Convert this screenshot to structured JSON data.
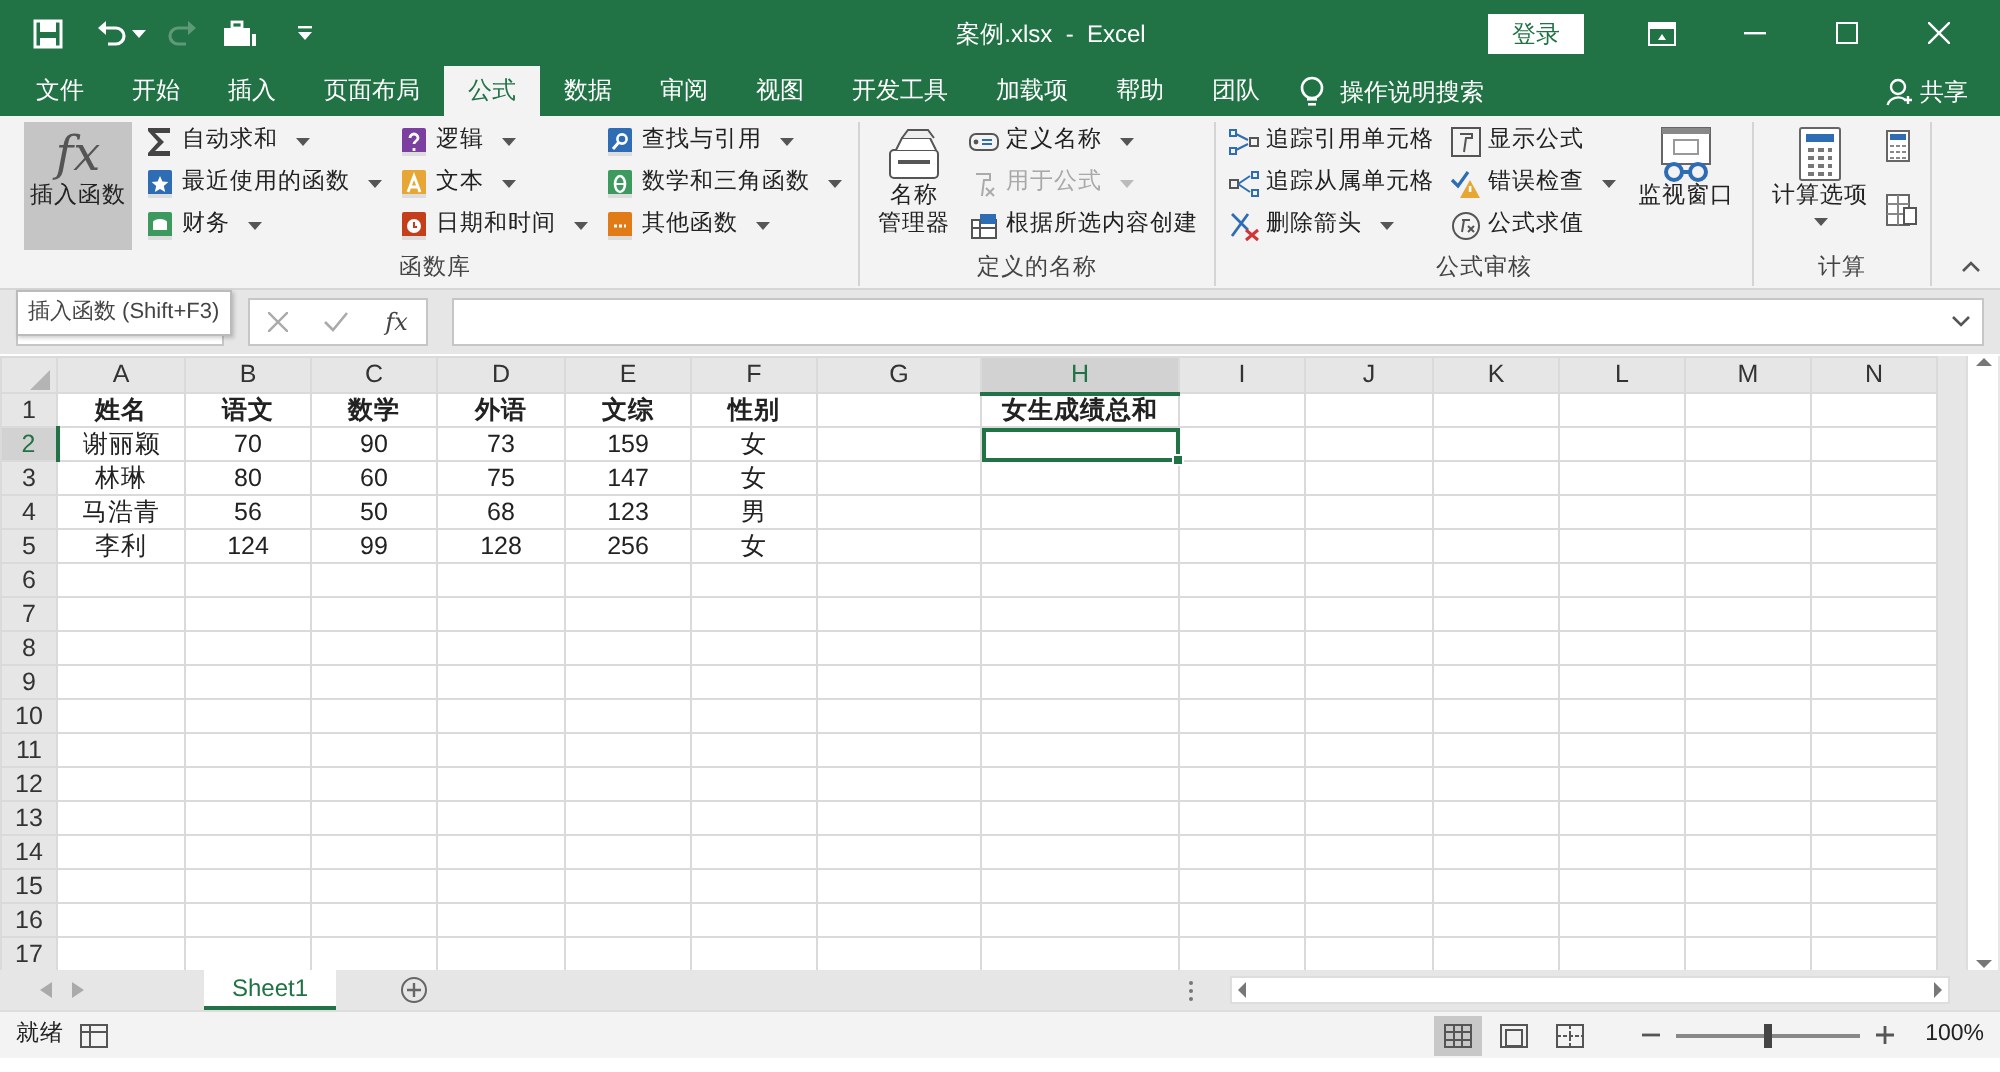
{
  "window": {
    "title": "案例.xlsx  -  Excel",
    "login": "登录"
  },
  "tabs": [
    {
      "label": "文件",
      "selected": false
    },
    {
      "label": "开始",
      "selected": false
    },
    {
      "label": "插入",
      "selected": false
    },
    {
      "label": "页面布局",
      "selected": false
    },
    {
      "label": "公式",
      "selected": true
    },
    {
      "label": "数据",
      "selected": false
    },
    {
      "label": "审阅",
      "selected": false
    },
    {
      "label": "视图",
      "selected": false
    },
    {
      "label": "开发工具",
      "selected": false
    },
    {
      "label": "加载项",
      "selected": false
    },
    {
      "label": "帮助",
      "selected": false
    },
    {
      "label": "团队",
      "selected": false
    }
  ],
  "tell_me": "操作说明搜索",
  "share": "共享",
  "ribbon": [
    {
      "label": "函数库",
      "large": [
        {
          "label": "插入函数",
          "glyph": "fx",
          "pressed": true
        }
      ],
      "columns": [
        [
          {
            "label": "自动求和",
            "dropdown": true
          },
          {
            "label": "最近使用的函数",
            "dropdown": true
          },
          {
            "label": "财务",
            "dropdown": true
          }
        ],
        [
          {
            "label": "逻辑",
            "dropdown": true
          },
          {
            "label": "文本",
            "dropdown": true
          },
          {
            "label": "日期和时间",
            "dropdown": true
          }
        ],
        [
          {
            "label": "查找与引用",
            "dropdown": true
          },
          {
            "label": "数学和三角函数",
            "dropdown": true
          },
          {
            "label": "其他函数",
            "dropdown": true
          }
        ]
      ]
    },
    {
      "label": "定义的名称",
      "large": [
        {
          "label": [
            "名称",
            "管理器"
          ],
          "pressed": false
        }
      ],
      "columns": [
        [
          {
            "label": "定义名称",
            "dropdown": true,
            "disabled": false
          },
          {
            "label": "用于公式",
            "dropdown": true,
            "disabled": true
          },
          {
            "label": "根据所选内容创建",
            "dropdown": false,
            "disabled": false
          }
        ]
      ]
    },
    {
      "label": "公式审核",
      "columns": [
        [
          {
            "label": "追踪引用单元格",
            "dropdown": false
          },
          {
            "label": "追踪从属单元格",
            "dropdown": false
          },
          {
            "label": "删除箭头",
            "dropdown": true
          }
        ],
        [
          {
            "label": "显示公式",
            "dropdown": false
          },
          {
            "label": "错误检查",
            "dropdown": true
          },
          {
            "label": "公式求值",
            "dropdown": false
          }
        ]
      ],
      "large_after": [
        {
          "label": "监视窗口",
          "pressed": false
        }
      ]
    },
    {
      "label": "计算",
      "large": [
        {
          "label": "计算选项",
          "dropdown": true,
          "pressed": false
        }
      ]
    }
  ],
  "tooltip": "插入函数 (Shift+F3)",
  "formula_bar": {
    "fx": "fx"
  },
  "columns": [
    {
      "letter": "A",
      "selected": false
    },
    {
      "letter": "B",
      "selected": false
    },
    {
      "letter": "C",
      "selected": false
    },
    {
      "letter": "D",
      "selected": false
    },
    {
      "letter": "E",
      "selected": false
    },
    {
      "letter": "F",
      "selected": false
    },
    {
      "letter": "G",
      "selected": false
    },
    {
      "letter": "H",
      "selected": true
    },
    {
      "letter": "I",
      "selected": false
    },
    {
      "letter": "J",
      "selected": false
    },
    {
      "letter": "K",
      "selected": false
    },
    {
      "letter": "L",
      "selected": false
    },
    {
      "letter": "M",
      "selected": false
    },
    {
      "letter": "N",
      "selected": false
    }
  ],
  "rows": [
    {
      "number": "1",
      "selected": false,
      "bold": true,
      "cells": [
        "姓名",
        "语文",
        "数学",
        "外语",
        "文综",
        "性别",
        null,
        "女生成绩总和"
      ]
    },
    {
      "number": "2",
      "selected": true,
      "cells": [
        "谢丽颖",
        "70",
        "90",
        "73",
        "159",
        "女"
      ]
    },
    {
      "number": "3",
      "selected": false,
      "cells": [
        "林琳",
        "80",
        "60",
        "75",
        "147",
        "女"
      ]
    },
    {
      "number": "4",
      "selected": false,
      "cells": [
        "马浩青",
        "56",
        "50",
        "68",
        "123",
        "男"
      ]
    },
    {
      "number": "5",
      "selected": false,
      "cells": [
        "李利",
        "124",
        "99",
        "128",
        "256",
        "女"
      ]
    },
    {
      "number": "6",
      "selected": false
    },
    {
      "number": "7",
      "selected": false
    },
    {
      "number": "8",
      "selected": false
    },
    {
      "number": "9",
      "selected": false
    },
    {
      "number": "10",
      "selected": false
    },
    {
      "number": "11",
      "selected": false
    },
    {
      "number": "12",
      "selected": false
    },
    {
      "number": "13",
      "selected": false
    },
    {
      "number": "14",
      "selected": false
    },
    {
      "number": "15",
      "selected": false
    },
    {
      "number": "16",
      "selected": false
    },
    {
      "number": "17",
      "selected": false
    }
  ],
  "sheets": [
    {
      "label": "Sheet1",
      "selected": true
    }
  ],
  "status": {
    "text": "就绪",
    "zoom": {
      "level": 0.5,
      "reading": "100%"
    },
    "views": [
      {
        "selected": true
      },
      {
        "selected": false
      },
      {
        "selected": false
      }
    ]
  }
}
